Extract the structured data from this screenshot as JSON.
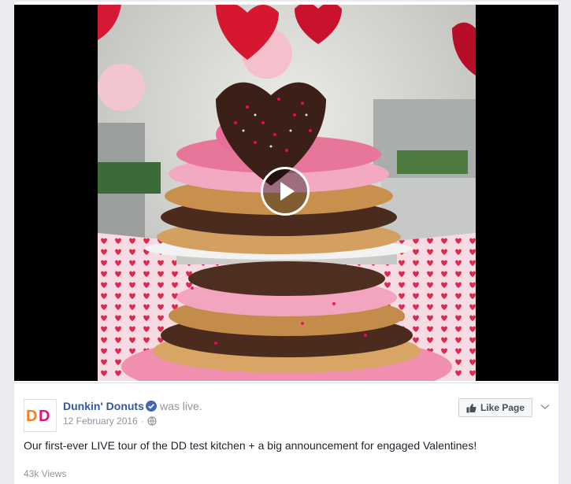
{
  "video": {
    "thumbnail": "valentines-donut-tower",
    "play_icon": "play-icon"
  },
  "post": {
    "page_logo_text": "DD",
    "page_name": "Dunkin' Donuts",
    "verified_icon": "verified-badge-icon",
    "status": "was live.",
    "date": "12 February 2016",
    "separator": "·",
    "privacy_icon": "globe-icon",
    "message": "Our first-ever LIVE tour of the DD test kitchen + a big announcement for engaged Valentines!",
    "views": "43k Views",
    "like_page_label": "Like Page",
    "like_icon": "thumbs-up-icon",
    "options_icon": "chevron-down-icon"
  },
  "colors": {
    "brand_orange": "#f5821f",
    "brand_pink": "#e11383",
    "link_blue": "#365899",
    "verified_blue": "#4267b2"
  }
}
